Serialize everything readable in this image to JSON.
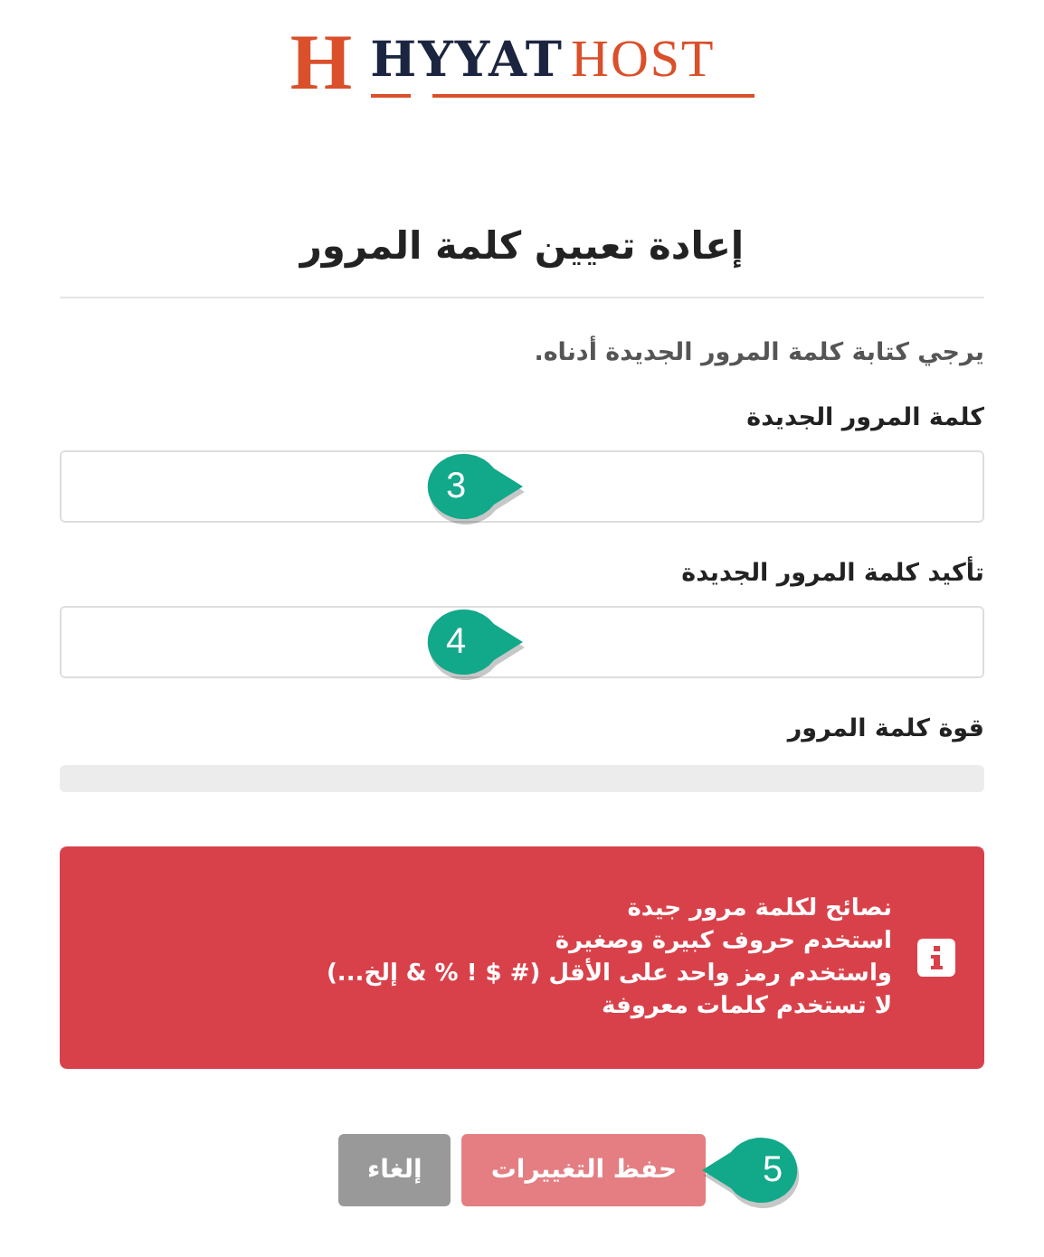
{
  "logo": {
    "mark": "H",
    "name": "HYYAT",
    "suffix": "HOST"
  },
  "title": "إعادة تعيين كلمة المرور",
  "intro": "يرجي كتابة كلمة المرور الجديدة أدناه.",
  "fields": [
    {
      "label": "كلمة المرور الجديدة",
      "callout": {
        "text": "3",
        "kind": "right"
      }
    },
    {
      "label": "تأكيد كلمة المرور الجديدة",
      "callout": {
        "text": "4",
        "kind": "right"
      }
    }
  ],
  "strength": {
    "label": "قوة كلمة المرور",
    "level": 0
  },
  "alert": {
    "lines": [
      "نصائح لكلمة مرور جيدة",
      "استخدم حروف كبيرة وصغيرة",
      "واستخدم رمز واحد على الأقل (# $ ! % & إلخ...)",
      "لا تستخدم كلمات معروفة"
    ]
  },
  "buttons": [
    {
      "kind": "primary",
      "label": "حفظ التغييرات",
      "disabled": true,
      "callout": {
        "text": "5",
        "kind": "left"
      }
    },
    {
      "kind": "secondary",
      "label": "إلغاء",
      "disabled": false
    }
  ]
}
